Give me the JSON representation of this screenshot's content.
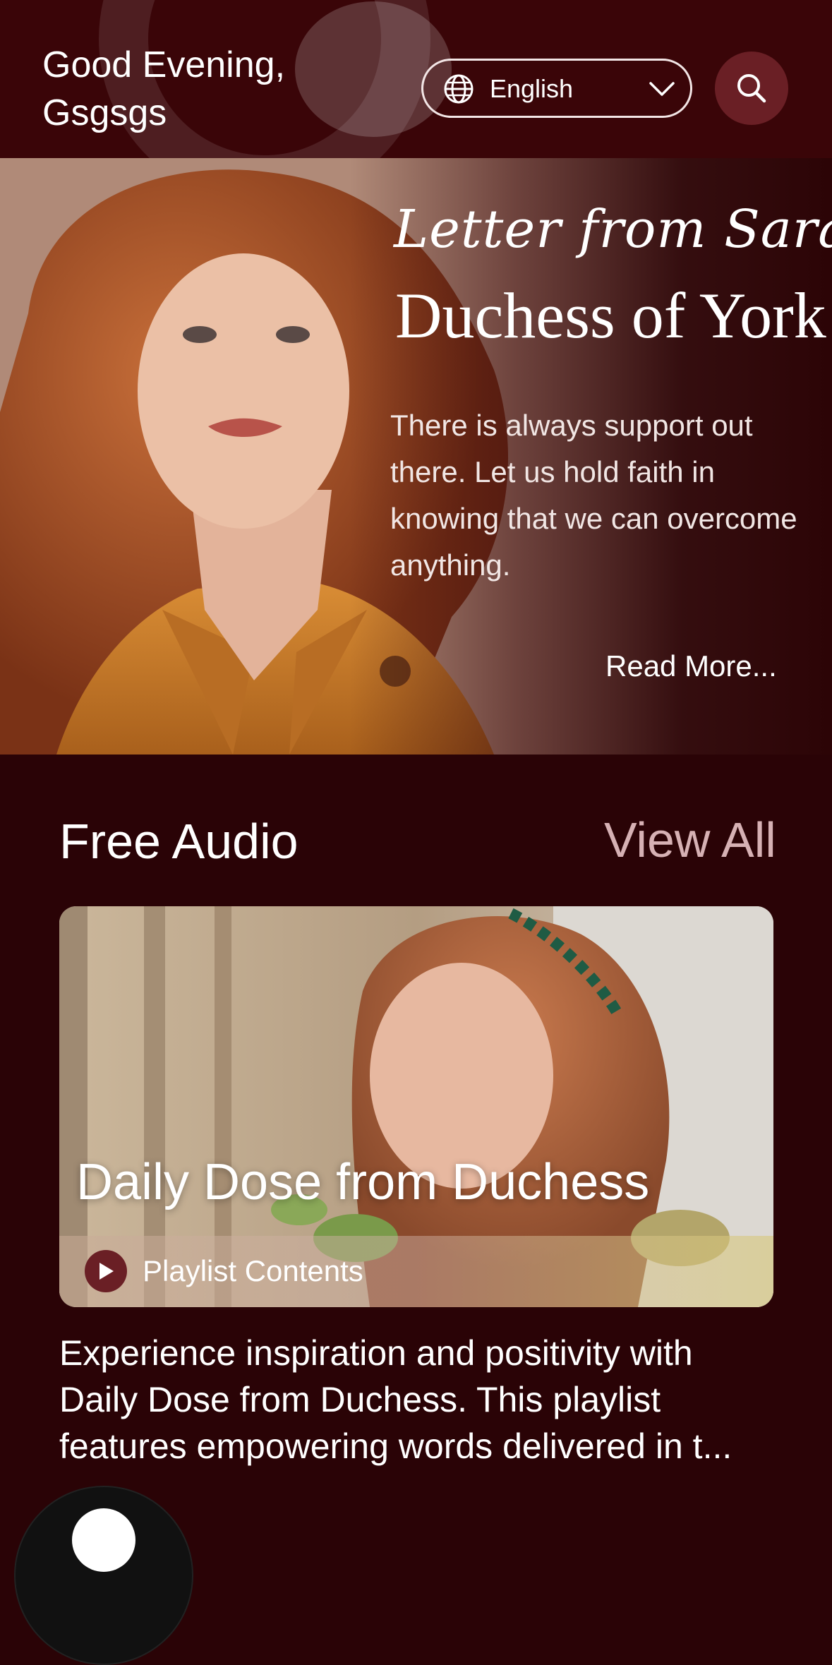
{
  "header": {
    "greeting_line1": "Good Evening,",
    "greeting_line2": "Gsgsgs",
    "language": "English",
    "icons": [
      "globe-icon",
      "chevron-down-icon",
      "search-icon"
    ]
  },
  "letter": {
    "script_line": "Letter from Sarah",
    "title": "Duchess of York",
    "body": "There is always support out there. Let us hold faith in knowing that we can overcome anything.",
    "read_more": "Read More..."
  },
  "free_audio": {
    "title": "Free Audio",
    "view_all": "View All",
    "card": {
      "title": "Daily Dose from Duchess",
      "playlist_label": "Playlist Contents",
      "description": "Experience inspiration and positivity with Daily Dose from Duchess. This playlist features empowering words delivered in t..."
    }
  },
  "colors": {
    "background": "#2a0306",
    "header": "#3a0508",
    "accent": "#6a1f25",
    "view_all": "#d6b1b4"
  }
}
